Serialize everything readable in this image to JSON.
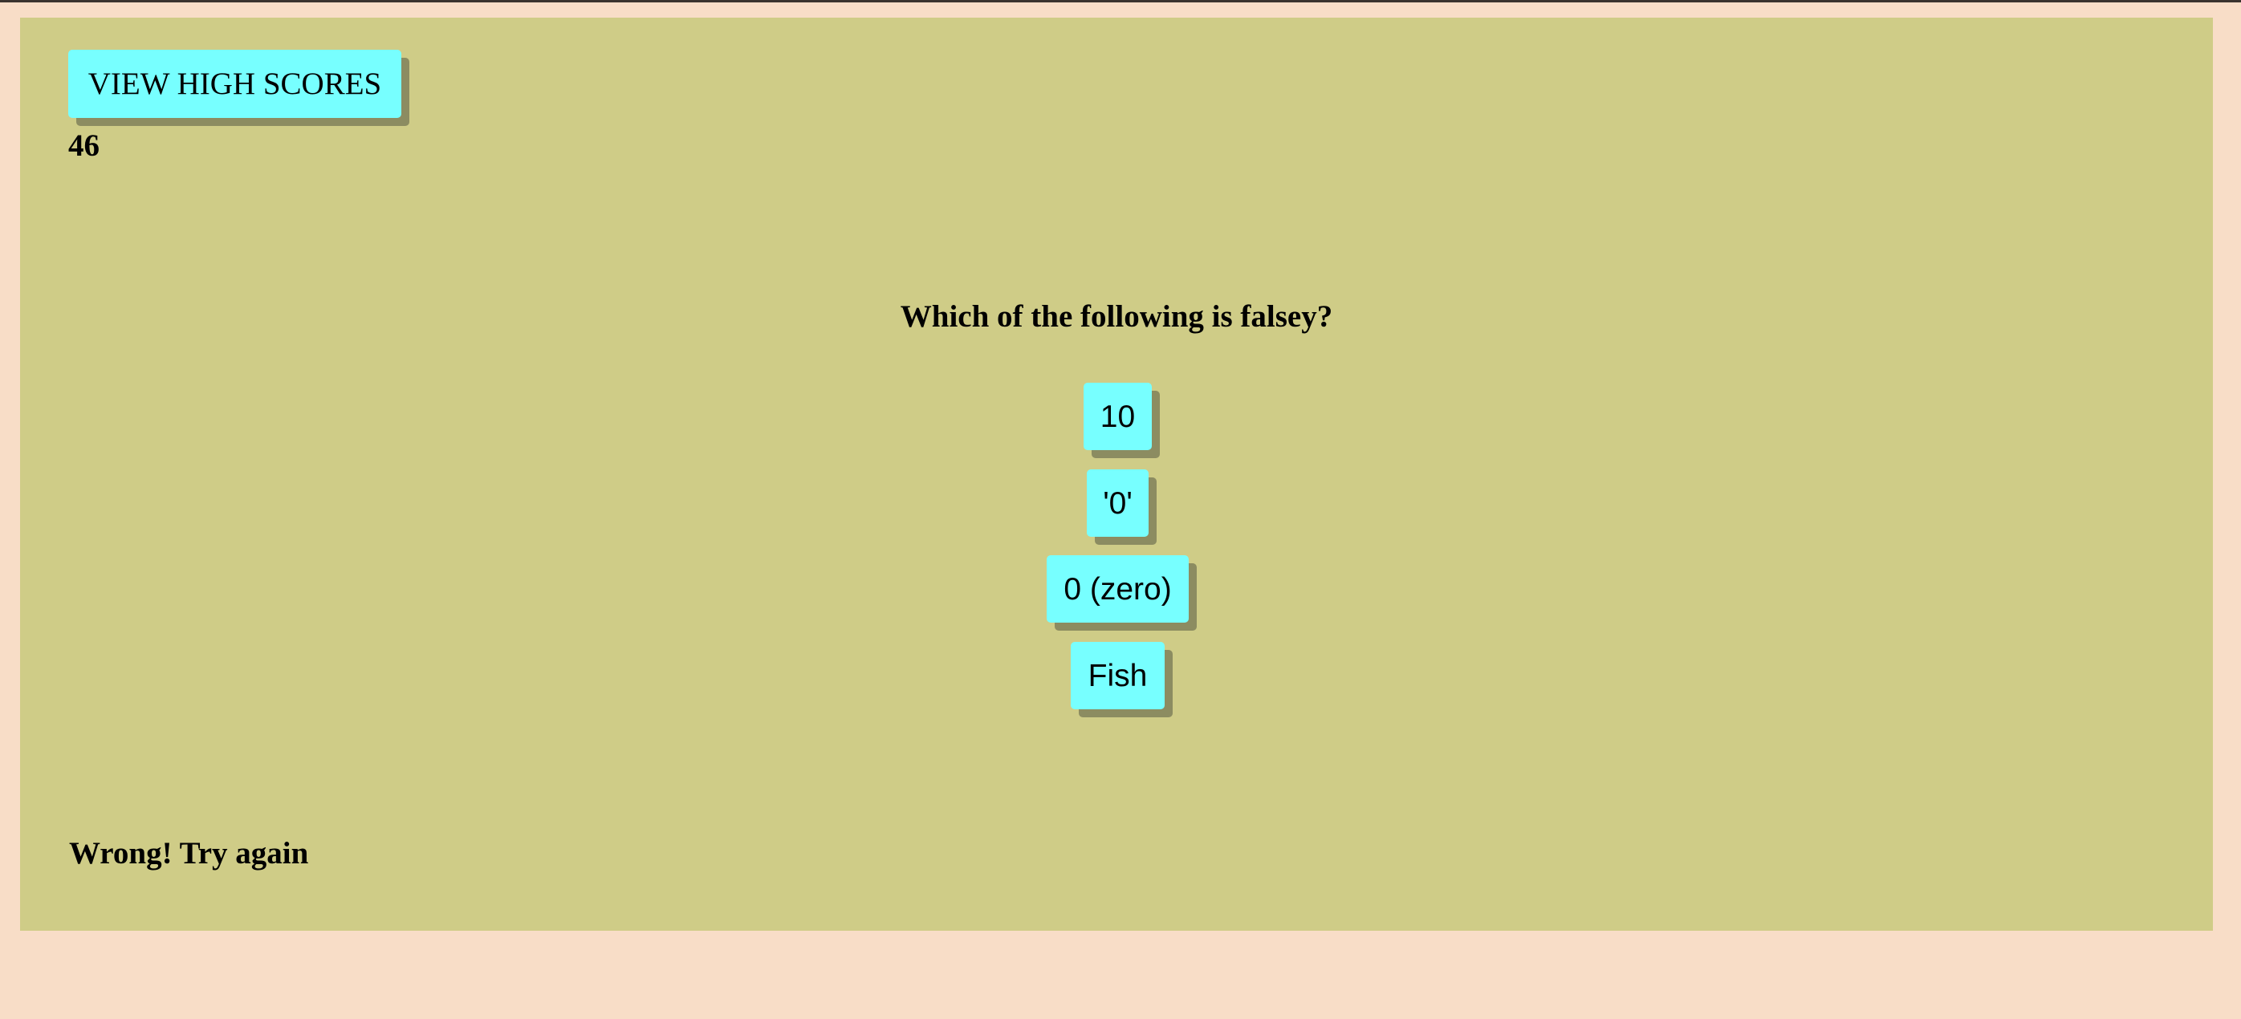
{
  "header": {
    "high_scores_label": "VIEW HIGH SCORES",
    "timer_value": "46"
  },
  "quiz": {
    "question": "Which of the following is falsey?",
    "answers": [
      {
        "label": "10"
      },
      {
        "label": "'0'"
      },
      {
        "label": "0 (zero)"
      },
      {
        "label": "Fish"
      }
    ],
    "feedback": "Wrong! Try again"
  },
  "colors": {
    "page_background": "#f8ddc7",
    "panel_background": "#cfcc87",
    "button_background": "#77ffff",
    "button_shadow": "#8c8c61",
    "text": "#000000"
  }
}
